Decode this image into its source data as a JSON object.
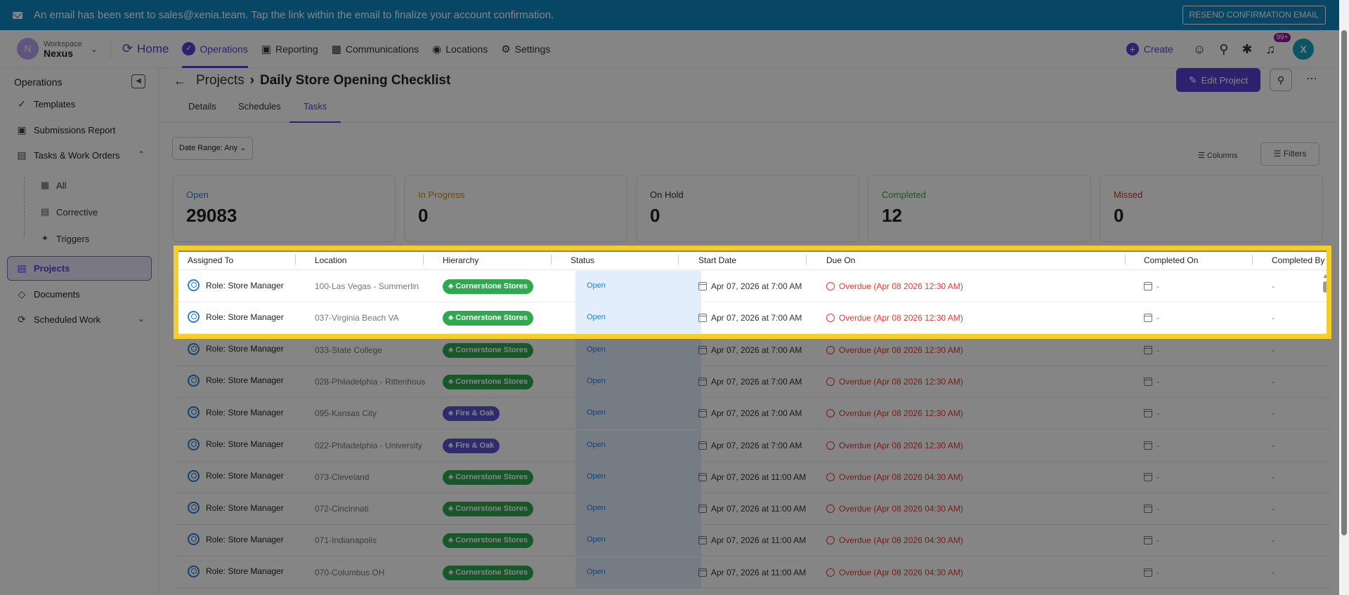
{
  "banner": {
    "message": "An email has been sent to sales@xenia.team. Tap the link within the email to finalize your account confirmation.",
    "resend_label": "RESEND CONFIRMATION EMAIL"
  },
  "workspace": {
    "label": "Workspace",
    "name": "Nexus",
    "initial": "N"
  },
  "nav": {
    "home": "Home",
    "operations": "Operations",
    "reporting": "Reporting",
    "communications": "Communications",
    "locations": "Locations",
    "settings": "Settings",
    "create": "Create",
    "notif_badge": "99+",
    "user_initial": "X"
  },
  "sidebar": {
    "title": "Operations",
    "items": {
      "templates": "Templates",
      "submissions": "Submissions Report",
      "tasks": "Tasks & Work Orders",
      "all": "All",
      "corrective": "Corrective",
      "triggers": "Triggers",
      "projects": "Projects",
      "documents": "Documents",
      "scheduled": "Scheduled Work"
    }
  },
  "header": {
    "breadcrumb_parent": "Projects",
    "breadcrumb_current": "Daily Store Opening Checklist",
    "edit_label": "Edit Project"
  },
  "tabs": [
    "Details",
    "Schedules",
    "Tasks"
  ],
  "toolbar": {
    "date_range": "Date Range: Any",
    "columns": "Columns",
    "filters": "Filters"
  },
  "stats": [
    {
      "label": "Open",
      "value": "29083",
      "color": "#2b7fd6"
    },
    {
      "label": "In Progress",
      "value": "0",
      "color": "#e08a00"
    },
    {
      "label": "On Hold",
      "value": "0",
      "color": "#333333"
    },
    {
      "label": "Completed",
      "value": "12",
      "color": "#2fa84f"
    },
    {
      "label": "Missed",
      "value": "0",
      "color": "#d32f2f"
    }
  ],
  "table": {
    "headers": [
      "Assigned To",
      "Location",
      "Hierarchy",
      "Status",
      "Start Date",
      "Due On",
      "Completed On",
      "Completed By"
    ],
    "rows": [
      {
        "assigned": "Role: Store Manager",
        "location": "100-Las Vegas - Summerlin",
        "hierarchy": "Cornerstone Stores",
        "hcolor": "green",
        "status": "Open",
        "start": "Apr 07, 2026 at 7:00 AM",
        "due": "Overdue (Apr 08 2026 12:30 AM)",
        "completed_on": "-",
        "completed_by": "-"
      },
      {
        "assigned": "Role: Store Manager",
        "location": "037-Virginia Beach VA",
        "hierarchy": "Cornerstone Stores",
        "hcolor": "green",
        "status": "Open",
        "start": "Apr 07, 2026 at 7:00 AM",
        "due": "Overdue (Apr 08 2026 12:30 AM)",
        "completed_on": "-",
        "completed_by": "-"
      },
      {
        "assigned": "Role: Store Manager",
        "location": "033-State College",
        "hierarchy": "Cornerstone Stores",
        "hcolor": "green",
        "status": "Open",
        "start": "Apr 07, 2026 at 7:00 AM",
        "due": "Overdue (Apr 08 2026 12:30 AM)",
        "completed_on": "-",
        "completed_by": "-"
      },
      {
        "assigned": "Role: Store Manager",
        "location": "028-Philadelphia - Rittenhouse",
        "hierarchy": "Cornerstone Stores",
        "hcolor": "green",
        "status": "Open",
        "start": "Apr 07, 2026 at 7:00 AM",
        "due": "Overdue (Apr 08 2026 12:30 AM)",
        "completed_on": "-",
        "completed_by": "-"
      },
      {
        "assigned": "Role: Store Manager",
        "location": "095-Kansas City",
        "hierarchy": "Fire & Oak",
        "hcolor": "purple",
        "status": "Open",
        "start": "Apr 07, 2026 at 7:00 AM",
        "due": "Overdue (Apr 08 2026 12:30 AM)",
        "completed_on": "-",
        "completed_by": "-"
      },
      {
        "assigned": "Role: Store Manager",
        "location": "022-Philadelphia - University",
        "hierarchy": "Fire & Oak",
        "hcolor": "purple",
        "status": "Open",
        "start": "Apr 07, 2026 at 7:00 AM",
        "due": "Overdue (Apr 08 2026 12:30 AM)",
        "completed_on": "-",
        "completed_by": "-"
      },
      {
        "assigned": "Role: Store Manager",
        "location": "073-Cleveland",
        "hierarchy": "Cornerstone Stores",
        "hcolor": "green",
        "status": "Open",
        "start": "Apr 07, 2026 at 11:00 AM",
        "due": "Overdue (Apr 08 2026 04:30 AM)",
        "completed_on": "-",
        "completed_by": "-"
      },
      {
        "assigned": "Role: Store Manager",
        "location": "072-Cincinnati",
        "hierarchy": "Cornerstone Stores",
        "hcolor": "green",
        "status": "Open",
        "start": "Apr 07, 2026 at 11:00 AM",
        "due": "Overdue (Apr 08 2026 04:30 AM)",
        "completed_on": "-",
        "completed_by": "-"
      },
      {
        "assigned": "Role: Store Manager",
        "location": "071-Indianapolis",
        "hierarchy": "Cornerstone Stores",
        "hcolor": "green",
        "status": "Open",
        "start": "Apr 07, 2026 at 11:00 AM",
        "due": "Overdue (Apr 08 2026 04:30 AM)",
        "completed_on": "-",
        "completed_by": "-"
      },
      {
        "assigned": "Role: Store Manager",
        "location": "070-Columbus OH",
        "hierarchy": "Cornerstone Stores",
        "hcolor": "green",
        "status": "Open",
        "start": "Apr 07, 2026 at 11:00 AM",
        "due": "Overdue (Apr 08 2026 04:30 AM)",
        "completed_on": "-",
        "completed_by": "-"
      }
    ]
  }
}
